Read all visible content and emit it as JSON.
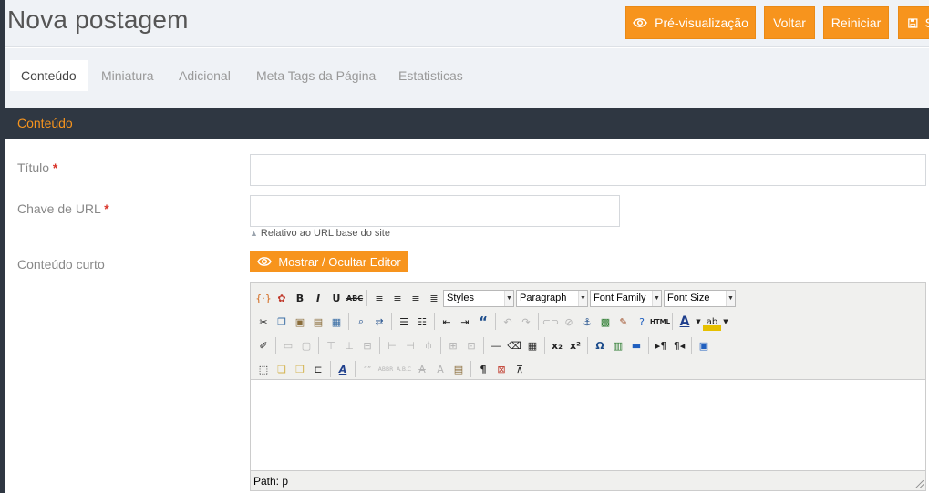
{
  "page": {
    "title": "Nova postagem"
  },
  "header_buttons": {
    "preview": "Pré-visualização",
    "back": "Voltar",
    "reset": "Reiniciar",
    "save": "S"
  },
  "tabs": [
    {
      "label": "Conteúdo",
      "active": true
    },
    {
      "label": "Miniatura",
      "active": false
    },
    {
      "label": "Adicional",
      "active": false
    },
    {
      "label": "Meta Tags da Página",
      "active": false
    },
    {
      "label": "Estatisticas",
      "active": false
    }
  ],
  "section": {
    "title": "Conteúdo"
  },
  "form": {
    "title_label": "Título",
    "title_value": "",
    "url_label": "Chave de URL",
    "url_value": "",
    "url_help": "Relativo ao URL base do site",
    "required_mark": "*",
    "short_content_label": "Conteúdo curto",
    "toggle_editor": "Mostrar / Ocultar Editor"
  },
  "editor": {
    "styles": "Styles",
    "format": "Paragraph",
    "font_family": "Font Family",
    "font_size": "Font Size",
    "path": "Path: p"
  },
  "colors": {
    "accent": "#f7941d",
    "dark_bar": "#2f3742",
    "header_bg": "#eff2f6"
  }
}
